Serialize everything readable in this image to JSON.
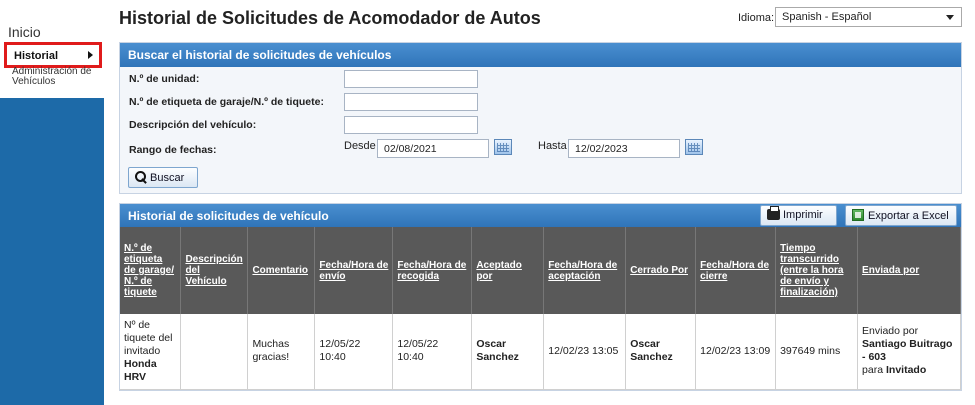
{
  "sidebar": {
    "home": "Inicio",
    "items": [
      {
        "label": "Historial"
      },
      {
        "label": "Administración de Vehículos"
      }
    ]
  },
  "header": {
    "title": "Historial de Solicitudes de Acomodador de Autos",
    "language_label": "Idioma:",
    "language_value": "Spanish - Español"
  },
  "search": {
    "panel_title": "Buscar el historial de solicitudes de vehículos",
    "unit_label": "N.º de unidad:",
    "ticket_label": "N.º de etiqueta de garaje/N.º de tiquete:",
    "description_label": "Descripción del vehículo:",
    "date_range_label": "Rango de fechas:",
    "from_label": "Desde",
    "from_value": "02/08/2021",
    "to_label": "Hasta",
    "to_value": "12/02/2023",
    "search_button": "Buscar"
  },
  "history": {
    "panel_title": "Historial de solicitudes de vehículo",
    "print_button": "Imprimir",
    "export_button": "Exportar a Excel",
    "columns": [
      "N.º de etiqueta de garage/ N.º de tiquete",
      "Descripción del Vehículo",
      "Comentario",
      "Fecha/Hora de envío",
      "Fecha/Hora de recogida",
      "Aceptado por",
      "Fecha/Hora de aceptación",
      "Cerrado Por",
      "Fecha/Hora de cierre",
      "Tiempo transcurrido (entre la hora de envío y finalización)",
      "Enviada por"
    ],
    "rows": [
      {
        "ticket_text": "Nº de tiquete del invitado",
        "ticket_vehicle": "Honda HRV",
        "description": "",
        "comment": "Muchas gracias!",
        "sent": "12/05/22 10:40",
        "pickup": "12/05/22 10:40",
        "accepted_by": "Oscar Sanchez",
        "accepted_at": "12/02/23 13:05",
        "closed_by": "Oscar Sanchez",
        "closed_at": "12/02/23 13:09",
        "elapsed": "397649 mins",
        "sent_by_prefix": "Enviado por",
        "sent_by_name": "Santiago Buitrago - 603",
        "sent_by_for": "para",
        "sent_by_role": "Invitado"
      }
    ]
  }
}
